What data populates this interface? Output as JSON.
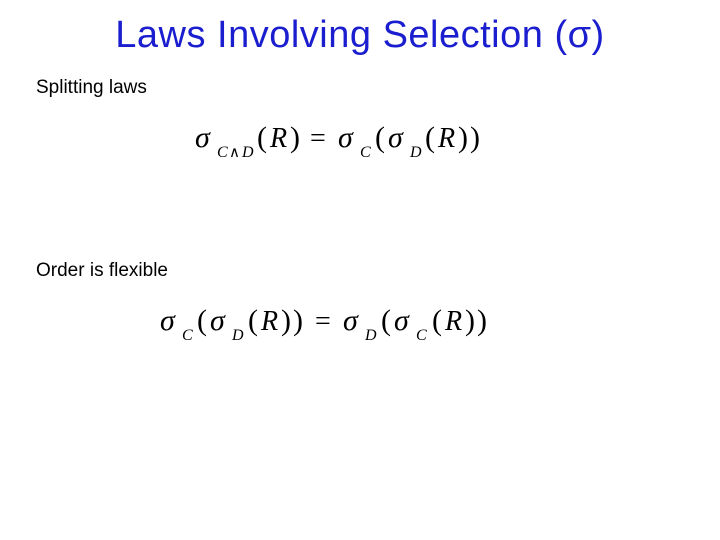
{
  "title": "Laws Involving Selection (σ)",
  "sections": {
    "splitting": {
      "label": "Splitting laws",
      "formula_latex": "\\sigma_{C \\wedge D}(R) = \\sigma_{C}(\\sigma_{D}(R))"
    },
    "order": {
      "label": "Order is flexible",
      "formula_latex": "\\sigma_{C}(\\sigma_{D}(R)) = \\sigma_{D}(\\sigma_{C}(R))"
    }
  }
}
